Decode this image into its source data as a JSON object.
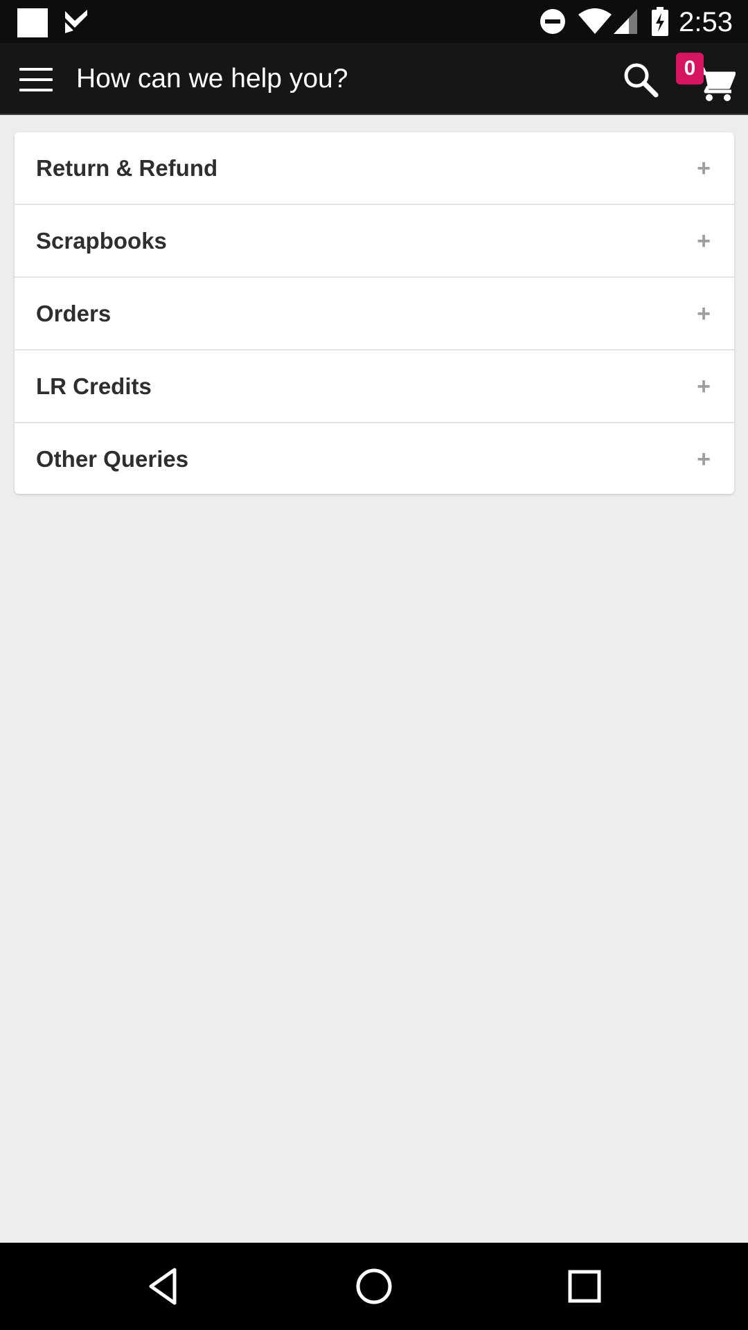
{
  "status_bar": {
    "time": "2:53",
    "icons": [
      "notification-square-icon",
      "checkmark-app-icon",
      "do-not-disturb-icon",
      "wifi-icon",
      "cell-signal-icon",
      "battery-charging-icon"
    ]
  },
  "app_bar": {
    "title": "How can we help you?",
    "cart_count": "0",
    "badge_color": "#d6145f",
    "icons": [
      "menu-icon",
      "search-icon",
      "cart-icon"
    ]
  },
  "faq": {
    "items": [
      {
        "label": "Return & Refund",
        "toggle": "+"
      },
      {
        "label": "Scrapbooks",
        "toggle": "+"
      },
      {
        "label": "Orders",
        "toggle": "+"
      },
      {
        "label": "LR Credits",
        "toggle": "+"
      },
      {
        "label": "Other Queries",
        "toggle": "+"
      }
    ]
  },
  "nav_bar": {
    "icons": [
      "back-icon",
      "home-icon",
      "recents-icon"
    ]
  }
}
